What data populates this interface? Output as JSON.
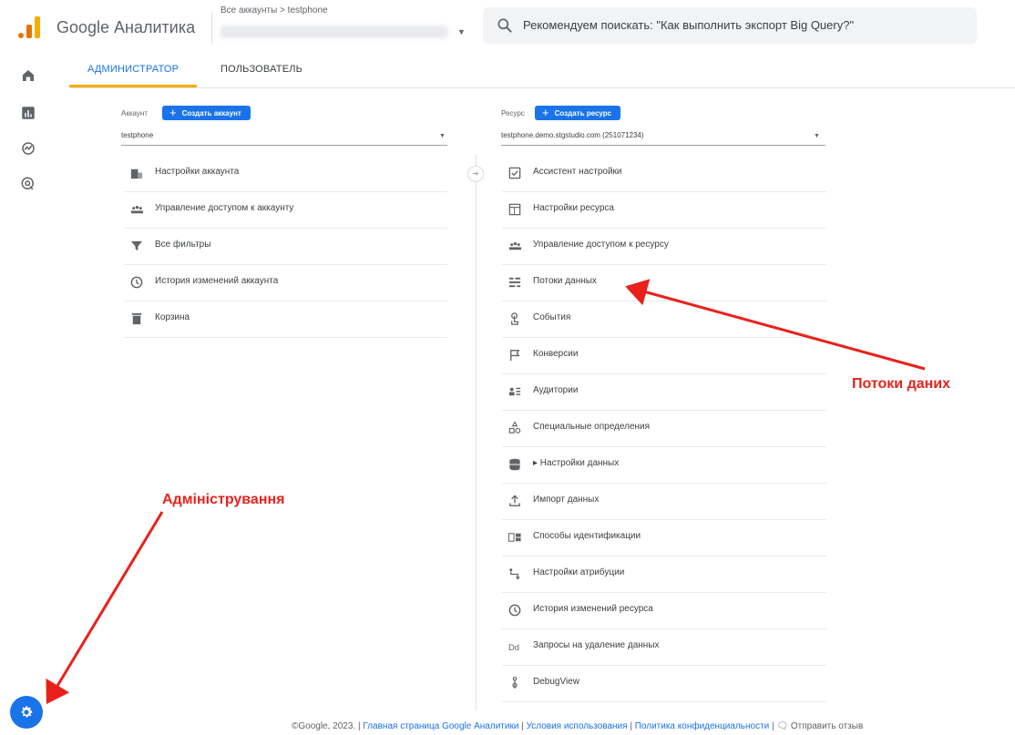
{
  "app": {
    "name": "Google Аналитика"
  },
  "account_picker": {
    "breadcrumb": "Все аккаунты > testphone"
  },
  "search": {
    "placeholder": "Рекомендуем поискать: \"Как выполнить экспорт Big Query?\""
  },
  "tabs": [
    {
      "label": "АДМИНИСТРАТОР",
      "active": true
    },
    {
      "label": "ПОЛЬЗОВАТЕЛЬ",
      "active": false
    }
  ],
  "account_column": {
    "label": "Аккаунт",
    "create_button": "Создать аккаунт",
    "selected": "testphone",
    "items": [
      {
        "label": "Настройки аккаунта",
        "icon": "building-icon"
      },
      {
        "label": "Управление доступом к аккаунту",
        "icon": "people-icon"
      },
      {
        "label": "Все фильтры",
        "icon": "filter-icon"
      },
      {
        "label": "История изменений аккаунта",
        "icon": "history-icon"
      },
      {
        "label": "Корзина",
        "icon": "trash-icon"
      }
    ]
  },
  "property_column": {
    "label": "Ресурс",
    "create_button": "Создать ресурс",
    "selected": "testphone.demo.stgstudio.com (251071234)",
    "items": [
      {
        "label": "Ассистент настройки",
        "icon": "checkbox-icon"
      },
      {
        "label": "Настройки ресурса",
        "icon": "window-icon"
      },
      {
        "label": "Управление доступом к ресурсу",
        "icon": "people-icon"
      },
      {
        "label": "Потоки данных",
        "icon": "streams-icon"
      },
      {
        "label": "События",
        "icon": "touch-icon"
      },
      {
        "label": "Конверсии",
        "icon": "flag-icon"
      },
      {
        "label": "Аудитории",
        "icon": "audience-icon"
      },
      {
        "label": "Специальные определения",
        "icon": "shapes-icon"
      },
      {
        "label": "▸ Настройки данных",
        "icon": "database-icon"
      },
      {
        "label": "Импорт данных",
        "icon": "upload-icon"
      },
      {
        "label": "Способы идентификации",
        "icon": "id-icon"
      },
      {
        "label": "Настройки атрибуции",
        "icon": "attribution-icon"
      },
      {
        "label": "История изменений ресурса",
        "icon": "history-icon"
      },
      {
        "label": "Запросы на удаление данных",
        "icon": "dd-icon"
      },
      {
        "label": "DebugView",
        "icon": "debug-icon"
      }
    ]
  },
  "footer": {
    "copyright": "©Google, 2023. | ",
    "links": [
      "Главная страница Google Аналитики",
      "Условия использования",
      "Политика конфиденциальности"
    ],
    "feedback": "Отправить отзыв"
  },
  "annotations": {
    "streams": "Потоки даних",
    "admin": "Адміністрування"
  },
  "colors": {
    "accent": "#1a73e8",
    "logo_orange": "#f9ab00",
    "annotation_red": "#e8221b"
  }
}
